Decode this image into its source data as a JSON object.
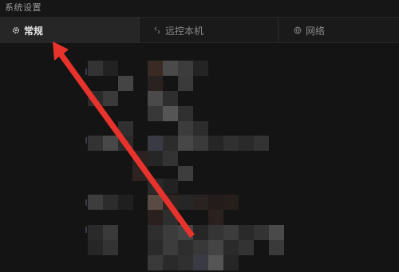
{
  "window": {
    "title": "系统设置"
  },
  "tabs": [
    {
      "label": "常规",
      "icon": "gear-icon",
      "active": true
    },
    {
      "label": "远控本机",
      "icon": "remote-icon",
      "active": false
    },
    {
      "label": "网络",
      "icon": "globe-icon",
      "active": false
    }
  ],
  "colors": {
    "background": "#141414",
    "tab_active": "#262626",
    "annotation_arrow": "#e8332c"
  }
}
